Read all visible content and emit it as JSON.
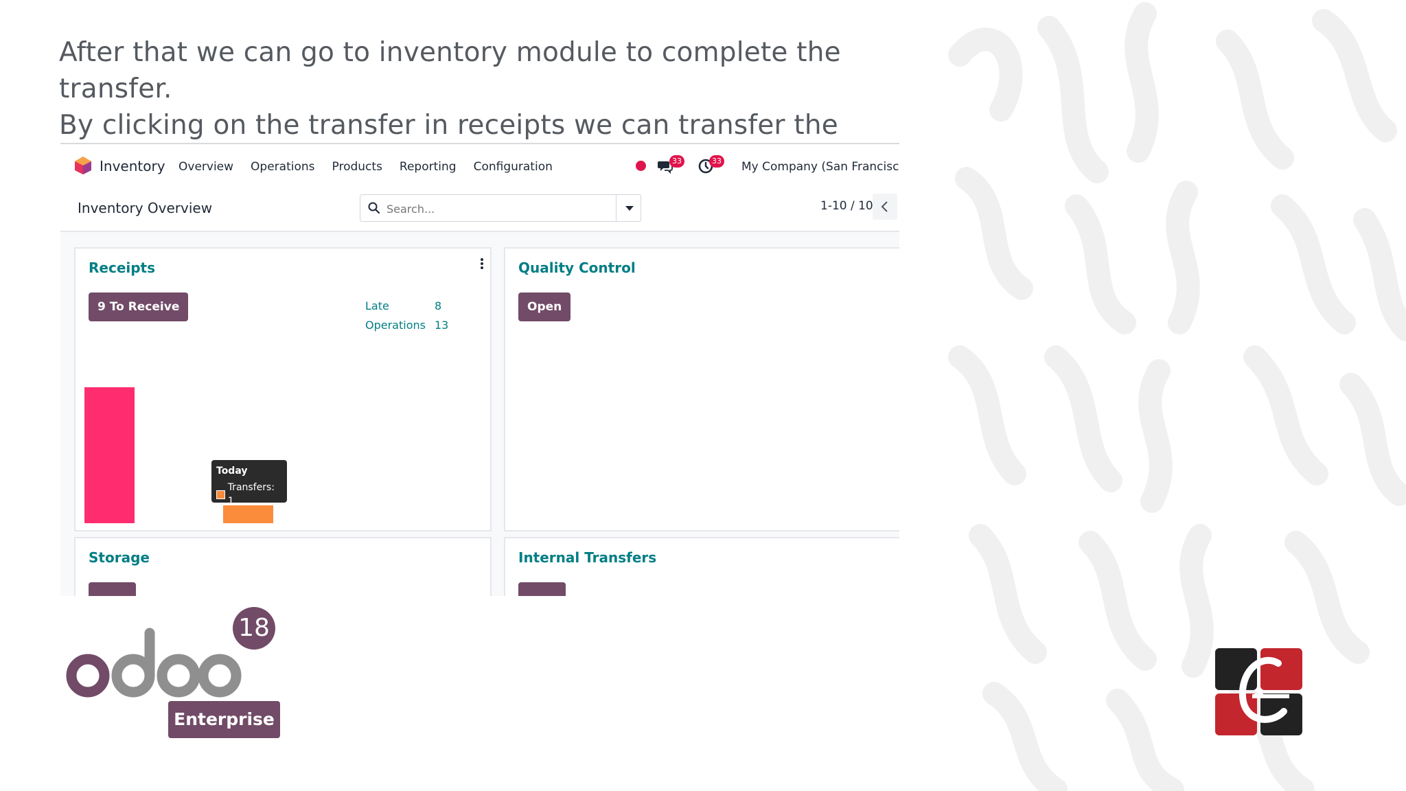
{
  "slide": {
    "caption_line1": "After that we can go to inventory module to complete the transfer.",
    "caption_line2": "By clicking on the transfer in receipts we can transfer the product."
  },
  "navbar": {
    "app_name": "Inventory",
    "app_icon": "inventory-app-icon",
    "menu": [
      "Overview",
      "Operations",
      "Products",
      "Reporting",
      "Configuration"
    ],
    "messages_count": "33",
    "activities_count": "33",
    "company": "My Company (San Francisco)"
  },
  "control_panel": {
    "title": "Inventory Overview",
    "search_placeholder": "Search...",
    "pager": "1-10 / 10"
  },
  "cards": {
    "receipts": {
      "title": "Receipts",
      "button": "9 To Receive",
      "stats": [
        {
          "label": "Late",
          "value": "8"
        },
        {
          "label": "Operations",
          "value": "13"
        }
      ],
      "tooltip": {
        "title": "Today",
        "text": "Transfers: 1"
      }
    },
    "quality": {
      "title": "Quality Control",
      "button": "Open"
    },
    "storage": {
      "title": "Storage"
    },
    "internal": {
      "title": "Internal Transfers"
    }
  },
  "branding": {
    "wordmark": "odoo",
    "version": "18",
    "edition": "Enterprise",
    "company_logo": "cybrosys-logo"
  },
  "colors": {
    "brand_purple": "#714b67",
    "teal": "#017e84",
    "alert_red": "#e0144c",
    "bar_pink": "#ff2d6f",
    "bar_orange": "#fb8c3c"
  }
}
